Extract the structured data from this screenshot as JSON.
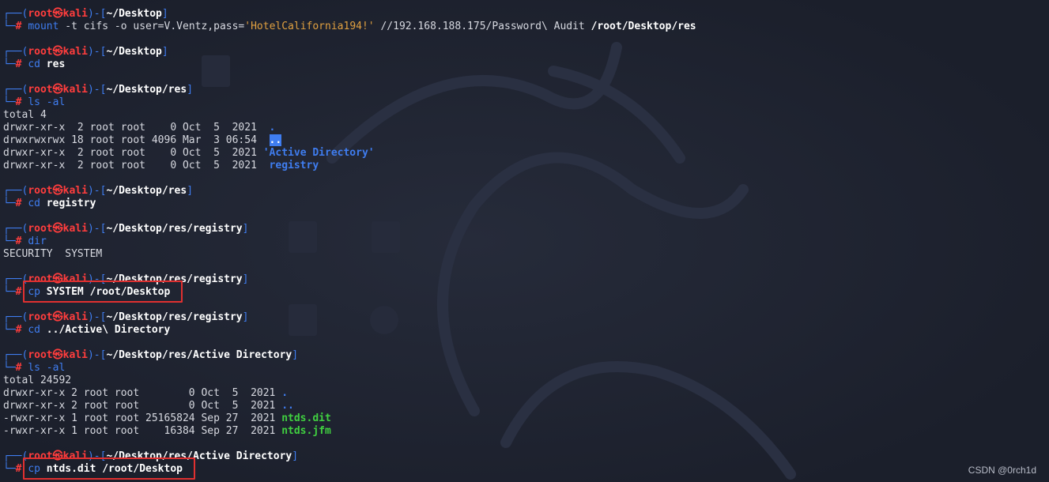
{
  "prompt": {
    "user": "root",
    "skull": "㉿",
    "host": "kali"
  },
  "blocks": [
    {
      "cwd": "~/Desktop",
      "command": "mount",
      "args": [
        {
          "text": " -t cifs -o user=V.Ventz,pass=",
          "style": "arg"
        },
        {
          "text": "'HotelCalifornia194!'",
          "style": "str"
        },
        {
          "text": " //192.168.188.175/Password\\ Audit ",
          "style": "arg"
        },
        {
          "text": "/root/Desktop/res",
          "style": "arg-bold"
        }
      ],
      "highlighted": false,
      "output": []
    },
    {
      "cwd": "~/Desktop",
      "command": "cd",
      "args": [
        {
          "text": " res",
          "style": "arg-bold"
        }
      ],
      "highlighted": false,
      "output": []
    },
    {
      "cwd": "~/Desktop/res",
      "command": "ls",
      "args": [
        {
          "text": " -al",
          "style": "cmd"
        }
      ],
      "highlighted": false,
      "output": [
        [
          {
            "text": "total 4",
            "style": "out"
          }
        ],
        [
          {
            "text": "drwxr-xr-x  2 root root    0 Oct  5  2021  ",
            "style": "out"
          },
          {
            "text": ".",
            "style": "dir"
          }
        ],
        [
          {
            "text": "drwxrwxrwx 18 root root 4096 Mar  3 06:54  ",
            "style": "out"
          },
          {
            "text": "..",
            "style": "dir-hl"
          }
        ],
        [
          {
            "text": "drwxr-xr-x  2 root root    0 Oct  5  2021 ",
            "style": "out"
          },
          {
            "text": "'Active Directory'",
            "style": "dir"
          }
        ],
        [
          {
            "text": "drwxr-xr-x  2 root root    0 Oct  5  2021  ",
            "style": "out"
          },
          {
            "text": "registry",
            "style": "dir"
          }
        ]
      ]
    },
    {
      "cwd": "~/Desktop/res",
      "command": "cd",
      "args": [
        {
          "text": " registry",
          "style": "arg-bold"
        }
      ],
      "highlighted": false,
      "output": []
    },
    {
      "cwd": "~/Desktop/res/registry",
      "command": "dir",
      "args": [],
      "highlighted": false,
      "output": [
        [
          {
            "text": "SECURITY  SYSTEM",
            "style": "out"
          }
        ]
      ]
    },
    {
      "cwd": "~/Desktop/res/registry",
      "command": "cp",
      "args": [
        {
          "text": " SYSTEM /root/Desktop",
          "style": "arg-bold"
        }
      ],
      "highlighted": true,
      "output": []
    },
    {
      "cwd": "~/Desktop/res/registry",
      "command": "cd",
      "args": [
        {
          "text": " ../Active\\ Directory",
          "style": "arg-bold"
        }
      ],
      "highlighted": false,
      "output": []
    },
    {
      "cwd": "~/Desktop/res/Active Directory",
      "command": "ls",
      "args": [
        {
          "text": " -al",
          "style": "cmd"
        }
      ],
      "highlighted": false,
      "output": [
        [
          {
            "text": "total 24592",
            "style": "out"
          }
        ],
        [
          {
            "text": "drwxr-xr-x 2 root root        0 Oct  5  2021 ",
            "style": "out"
          },
          {
            "text": ".",
            "style": "dir"
          }
        ],
        [
          {
            "text": "drwxr-xr-x 2 root root        0 Oct  5  2021 ",
            "style": "out"
          },
          {
            "text": "..",
            "style": "dir"
          }
        ],
        [
          {
            "text": "-rwxr-xr-x 1 root root 25165824 Sep 27  2021 ",
            "style": "out"
          },
          {
            "text": "ntds.dit",
            "style": "exe"
          }
        ],
        [
          {
            "text": "-rwxr-xr-x 1 root root    16384 Sep 27  2021 ",
            "style": "out"
          },
          {
            "text": "ntds.jfm",
            "style": "exe"
          }
        ]
      ]
    },
    {
      "cwd": "~/Desktop/res/Active Directory",
      "command": "cp",
      "args": [
        {
          "text": " ntds.dit /root/Desktop",
          "style": "arg-bold"
        }
      ],
      "highlighted": true,
      "output": []
    }
  ],
  "watermark": "CSDN @0rch1d",
  "colors": {
    "background": "#1f2330",
    "frame": "#3f7df0",
    "user": "#ff3d3d",
    "highlight_box": "#e03030",
    "executable": "#40d040"
  },
  "icons": [
    "kali-dragon-icon"
  ]
}
